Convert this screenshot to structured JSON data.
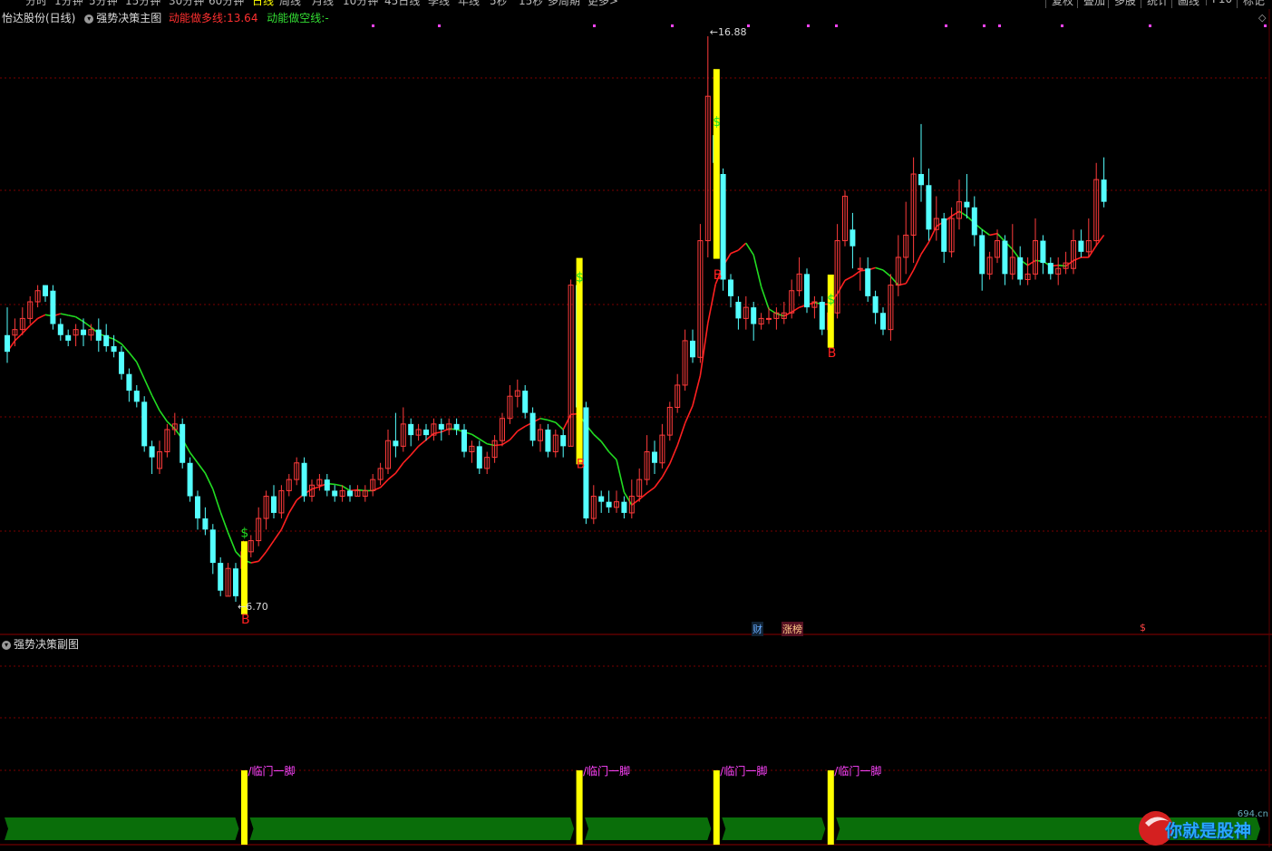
{
  "toolbar": {
    "periods": [
      "分时",
      "1分钟",
      "5分钟",
      "15分钟",
      "30分钟",
      "60分钟",
      "日线",
      "周线",
      "月线",
      "10分钟",
      "45日线",
      "季线",
      "年线",
      "5秒",
      "15秒",
      "多周期",
      "更多>"
    ],
    "active_period": "日线",
    "right_buttons": [
      "复权",
      "叠加",
      "多股",
      "统计",
      "画线",
      "F10",
      "标记"
    ]
  },
  "main_panel": {
    "stock_title": "怡达股份(日线)",
    "indicator_name": "强势决策主图",
    "long_line_label": "动能做多线:",
    "long_line_value": "13.64",
    "short_line_label": "动能做空线:",
    "short_line_value": "-",
    "high_label": "16.88",
    "low_label": "6.70",
    "buy_marker": "B",
    "sell_marker": "$",
    "event_tags": [
      "财",
      "涨榜"
    ],
    "small_sell_mark": "$"
  },
  "sub_panel": {
    "indicator_name": "强势决策副图",
    "signal_label": "临门一脚"
  },
  "watermark": {
    "text": "你就是股神",
    "site": "694.cn"
  },
  "colors": {
    "up_candle": "#ff3b3b",
    "down_candle": "#54ffff",
    "long_line": "#ff2020",
    "short_line": "#22dd22",
    "signal_bar": "#ffff00",
    "band": "#0a6e0a",
    "magenta": "#ff44ff"
  },
  "chart_data": {
    "type": "candlestick",
    "price_high": 16.88,
    "price_low": 6.7,
    "candles": [
      [
        11.5,
        11.2,
        12.0,
        11.0
      ],
      [
        11.5,
        11.6,
        11.8,
        11.3
      ],
      [
        11.6,
        11.8,
        12.0,
        11.5
      ],
      [
        11.8,
        12.1,
        12.2,
        11.7
      ],
      [
        12.1,
        12.3,
        12.4,
        12.0
      ],
      [
        12.4,
        12.2,
        12.4,
        12.1
      ],
      [
        12.3,
        11.7,
        12.4,
        11.6
      ],
      [
        11.7,
        11.5,
        11.8,
        11.4
      ],
      [
        11.5,
        11.4,
        11.6,
        11.3
      ],
      [
        11.5,
        11.6,
        11.7,
        11.3
      ],
      [
        11.6,
        11.5,
        11.8,
        11.3
      ],
      [
        11.5,
        11.6,
        11.7,
        11.4
      ],
      [
        11.6,
        11.4,
        11.8,
        11.2
      ],
      [
        11.5,
        11.3,
        11.7,
        11.2
      ],
      [
        11.3,
        11.2,
        11.5,
        11.1
      ],
      [
        11.2,
        10.8,
        11.3,
        10.7
      ],
      [
        10.8,
        10.5,
        10.9,
        10.3
      ],
      [
        10.5,
        10.3,
        10.6,
        10.2
      ],
      [
        10.3,
        9.5,
        10.4,
        9.4
      ],
      [
        9.5,
        9.3,
        9.6,
        9.0
      ],
      [
        9.1,
        9.4,
        9.6,
        9.0
      ],
      [
        9.4,
        9.8,
        9.9,
        9.3
      ],
      [
        9.8,
        9.9,
        10.1,
        9.7
      ],
      [
        9.9,
        9.2,
        10.0,
        9.1
      ],
      [
        9.2,
        8.6,
        9.3,
        8.5
      ],
      [
        8.6,
        8.2,
        8.7,
        8.0
      ],
      [
        8.2,
        8.0,
        8.4,
        7.9
      ],
      [
        8.0,
        7.4,
        8.1,
        7.2
      ],
      [
        7.4,
        6.9,
        7.5,
        6.8
      ],
      [
        6.8,
        7.3,
        7.4,
        6.8
      ],
      [
        7.3,
        6.8,
        7.4,
        6.7
      ],
      [
        7.3,
        7.6,
        7.8,
        7.2
      ],
      [
        7.6,
        7.8,
        7.9,
        7.5
      ],
      [
        7.8,
        8.2,
        8.4,
        7.7
      ],
      [
        8.2,
        8.6,
        8.7,
        8.0
      ],
      [
        8.6,
        8.3,
        8.8,
        8.2
      ],
      [
        8.3,
        8.7,
        8.8,
        8.2
      ],
      [
        8.7,
        8.9,
        9.0,
        8.6
      ],
      [
        8.9,
        9.2,
        9.3,
        8.8
      ],
      [
        9.2,
        8.6,
        9.3,
        8.5
      ],
      [
        8.6,
        8.8,
        8.9,
        8.5
      ],
      [
        8.8,
        8.9,
        9.0,
        8.7
      ],
      [
        8.9,
        8.7,
        9.0,
        8.6
      ],
      [
        8.7,
        8.6,
        8.8,
        8.5
      ],
      [
        8.6,
        8.7,
        8.8,
        8.5
      ],
      [
        8.7,
        8.6,
        8.8,
        8.5
      ],
      [
        8.6,
        8.7,
        8.8,
        8.6
      ],
      [
        8.6,
        8.7,
        8.8,
        8.5
      ],
      [
        8.7,
        8.9,
        9.0,
        8.6
      ],
      [
        8.9,
        9.1,
        9.2,
        8.8
      ],
      [
        9.1,
        9.6,
        9.8,
        9.0
      ],
      [
        9.6,
        9.5,
        10.1,
        9.3
      ],
      [
        9.5,
        9.9,
        10.2,
        9.4
      ],
      [
        9.9,
        9.7,
        10.0,
        9.5
      ],
      [
        9.7,
        9.8,
        9.9,
        9.6
      ],
      [
        9.8,
        9.7,
        9.9,
        9.6
      ],
      [
        9.7,
        9.9,
        10.0,
        9.6
      ],
      [
        9.9,
        9.8,
        10.0,
        9.6
      ],
      [
        9.8,
        9.9,
        10.0,
        9.7
      ],
      [
        9.9,
        9.8,
        10.0,
        9.7
      ],
      [
        9.8,
        9.4,
        9.9,
        9.3
      ],
      [
        9.4,
        9.5,
        9.6,
        9.2
      ],
      [
        9.5,
        9.1,
        9.6,
        9.0
      ],
      [
        9.1,
        9.3,
        9.4,
        9.0
      ],
      [
        9.3,
        9.6,
        9.7,
        9.2
      ],
      [
        9.6,
        10.0,
        10.1,
        9.5
      ],
      [
        10.0,
        10.4,
        10.6,
        9.9
      ],
      [
        10.4,
        10.5,
        10.7,
        10.2
      ],
      [
        10.5,
        10.1,
        10.6,
        10.0
      ],
      [
        10.1,
        9.6,
        10.2,
        9.5
      ],
      [
        9.6,
        9.8,
        9.9,
        9.4
      ],
      [
        9.8,
        9.4,
        9.9,
        9.3
      ],
      [
        9.4,
        9.7,
        9.8,
        9.3
      ],
      [
        9.7,
        9.5,
        9.8,
        9.3
      ],
      [
        9.5,
        12.4,
        12.5,
        9.5
      ],
      [
        12.4,
        10.2,
        12.4,
        10.1
      ],
      [
        10.2,
        8.2,
        10.3,
        8.1
      ],
      [
        8.2,
        8.6,
        8.8,
        8.1
      ],
      [
        8.6,
        8.5,
        8.7,
        8.3
      ],
      [
        8.5,
        8.4,
        8.7,
        8.3
      ],
      [
        8.4,
        8.5,
        8.7,
        8.3
      ],
      [
        8.5,
        8.3,
        8.6,
        8.2
      ],
      [
        8.3,
        8.6,
        8.9,
        8.2
      ],
      [
        8.6,
        8.9,
        9.1,
        8.5
      ],
      [
        8.9,
        9.4,
        9.7,
        8.8
      ],
      [
        9.4,
        9.2,
        9.6,
        9.0
      ],
      [
        9.2,
        9.7,
        9.9,
        9.1
      ],
      [
        9.7,
        10.2,
        10.3,
        9.6
      ],
      [
        10.2,
        10.6,
        10.8,
        10.1
      ],
      [
        10.6,
        11.4,
        11.6,
        10.5
      ],
      [
        11.4,
        11.1,
        11.6,
        11.0
      ],
      [
        11.1,
        13.2,
        13.5,
        11.0
      ],
      [
        13.2,
        15.8,
        16.88,
        12.9
      ],
      [
        15.1,
        14.6,
        15.2,
        14.5
      ],
      [
        14.4,
        12.5,
        14.5,
        12.3
      ],
      [
        12.5,
        12.2,
        12.6,
        12.0
      ],
      [
        12.1,
        11.8,
        12.2,
        11.6
      ],
      [
        11.8,
        12.0,
        12.2,
        11.6
      ],
      [
        12.0,
        11.7,
        12.1,
        11.4
      ],
      [
        11.7,
        11.8,
        11.9,
        11.6
      ],
      [
        11.8,
        11.8,
        12.0,
        11.7
      ],
      [
        11.8,
        11.9,
        12.0,
        11.6
      ],
      [
        11.8,
        11.9,
        12.1,
        11.7
      ],
      [
        11.9,
        12.3,
        12.5,
        11.8
      ],
      [
        12.3,
        12.6,
        12.9,
        12.2
      ],
      [
        12.6,
        12.0,
        12.7,
        11.9
      ],
      [
        12.0,
        12.1,
        12.2,
        11.8
      ],
      [
        12.1,
        11.6,
        12.2,
        11.5
      ],
      [
        11.6,
        11.9,
        12.0,
        11.5
      ],
      [
        11.9,
        13.2,
        13.5,
        11.8
      ],
      [
        13.2,
        14.0,
        14.1,
        13.1
      ],
      [
        13.4,
        13.1,
        13.7,
        12.7
      ],
      [
        12.7,
        12.7,
        12.9,
        12.3
      ],
      [
        12.7,
        12.2,
        12.9,
        12.1
      ],
      [
        12.2,
        11.9,
        12.3,
        11.7
      ],
      [
        11.9,
        11.6,
        12.0,
        11.5
      ],
      [
        11.6,
        12.4,
        12.6,
        11.4
      ],
      [
        12.4,
        12.9,
        13.3,
        12.2
      ],
      [
        12.9,
        13.3,
        13.9,
        12.6
      ],
      [
        13.3,
        14.4,
        14.7,
        12.8
      ],
      [
        14.4,
        14.2,
        15.3,
        13.9
      ],
      [
        14.2,
        13.4,
        14.5,
        13.2
      ],
      [
        13.4,
        13.6,
        14.0,
        13.2
      ],
      [
        13.6,
        13.0,
        13.7,
        12.8
      ],
      [
        13.0,
        13.6,
        13.8,
        12.9
      ],
      [
        13.6,
        13.9,
        14.3,
        13.4
      ],
      [
        13.9,
        13.8,
        14.4,
        13.6
      ],
      [
        13.8,
        13.3,
        14.0,
        13.1
      ],
      [
        13.3,
        12.6,
        13.4,
        12.3
      ],
      [
        12.6,
        12.9,
        13.0,
        12.5
      ],
      [
        12.9,
        13.2,
        13.4,
        12.8
      ],
      [
        13.2,
        12.6,
        13.3,
        12.4
      ],
      [
        12.6,
        12.9,
        13.5,
        12.5
      ],
      [
        12.9,
        12.5,
        13.1,
        12.4
      ],
      [
        12.5,
        12.6,
        12.9,
        12.4
      ],
      [
        12.6,
        13.2,
        13.6,
        12.5
      ],
      [
        13.2,
        12.8,
        13.3,
        12.6
      ],
      [
        12.8,
        12.6,
        12.9,
        12.5
      ],
      [
        12.6,
        12.7,
        12.9,
        12.4
      ],
      [
        12.7,
        12.8,
        13.0,
        12.6
      ],
      [
        12.7,
        13.2,
        13.4,
        12.6
      ],
      [
        13.2,
        13.0,
        13.4,
        12.9
      ],
      [
        13.0,
        13.2,
        13.6,
        12.9
      ],
      [
        13.2,
        14.3,
        14.6,
        13.1
      ],
      [
        14.3,
        13.9,
        14.7,
        13.8
      ]
    ],
    "markers": [
      {
        "type": "buy",
        "index": 30
      },
      {
        "type": "sell",
        "index": 31
      },
      {
        "type": "buy",
        "index": 74
      },
      {
        "type": "sell",
        "index": 75
      },
      {
        "type": "buy",
        "index": 92
      },
      {
        "type": "sell",
        "index": 93
      },
      {
        "type": "buy",
        "index": 107
      },
      {
        "type": "sell",
        "index": 108
      }
    ],
    "signal_bars": [
      30,
      74,
      92,
      107
    ]
  }
}
